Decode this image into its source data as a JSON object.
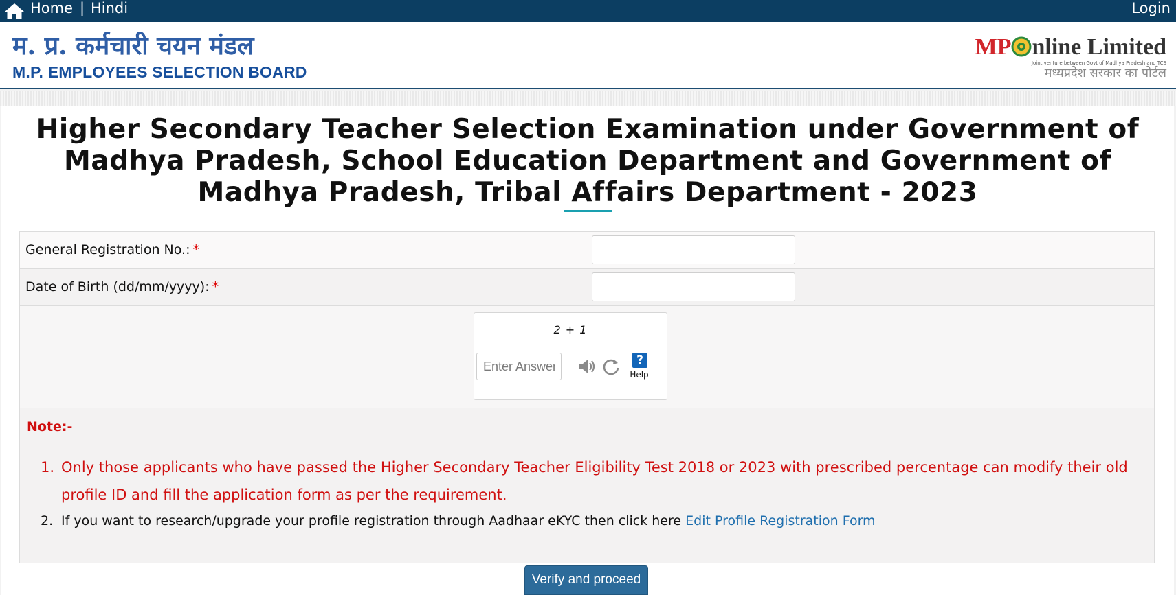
{
  "nav": {
    "home": "Home",
    "separator": "|",
    "hindi": "Hindi",
    "login": "Login"
  },
  "header": {
    "org_name_hindi": "म. प्र. कर्मचारी चयन मंडल",
    "org_name_english": "M.P. EMPLOYEES SELECTION BOARD",
    "partner_brand_mp": "MP",
    "partner_brand_rest": "nline Limited",
    "partner_tagline": "Joint venture between Govt of Madhya Pradesh and TCS",
    "partner_hindi": "मध्यप्रदेश सरकार का पोर्टल"
  },
  "page": {
    "title": "Higher Secondary Teacher Selection Examination under Government of Madhya Pradesh, School Education Department and Government of Madhya Pradesh, Tribal Affairs Department - 2023"
  },
  "form": {
    "registration_label": "General Registration No.:",
    "dob_label": "Date of Birth (dd/mm/yyyy):",
    "required_mark": "*",
    "registration_value": "",
    "dob_value": ""
  },
  "captcha": {
    "question": "2 + 1",
    "answer_placeholder": "Enter Answer",
    "help_symbol": "?",
    "help_label": "Help"
  },
  "notes": {
    "title": "Note:-",
    "items": [
      {
        "number": "1.",
        "text": "Only those applicants who have passed the Higher Secondary Teacher Eligibility Test 2018 or 2023 with prescribed percentage can modify their old profile ID and fill the application form as per the requirement."
      },
      {
        "number": "2.",
        "text": "If you want to research/upgrade your profile registration through Aadhaar eKYC then click here",
        "link": "Edit Profile Registration Form"
      }
    ]
  },
  "actions": {
    "submit": "Verify and proceed"
  },
  "colors": {
    "nav_bg": "#0c3e62",
    "note_red": "#d01010",
    "link_blue": "#1f6fae",
    "button_blue": "#2c6b9a"
  },
  "icons": [
    "home-icon",
    "speaker-icon",
    "refresh-icon",
    "help-icon",
    "globe-icon"
  ]
}
